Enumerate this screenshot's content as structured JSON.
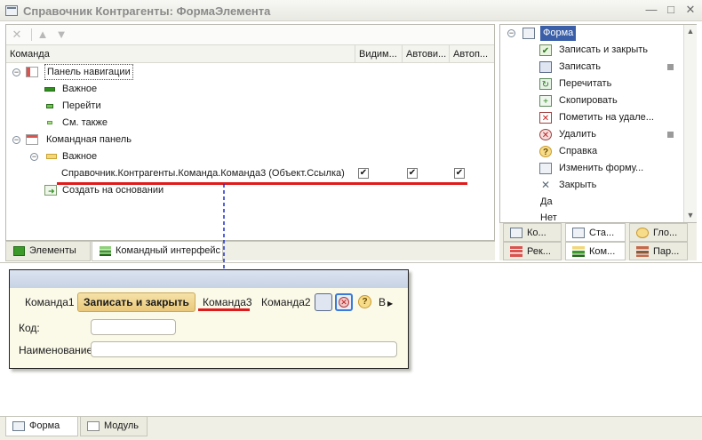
{
  "window": {
    "title": "Справочник Контрагенты: ФормаЭлемента",
    "minimize": "—",
    "maximize": "□",
    "close": "✕"
  },
  "toolbar": {
    "delete_icon": "delete-icon",
    "move_up_icon": "arrow-up-icon",
    "move_down_icon": "arrow-down-icon"
  },
  "commands_table": {
    "columns": [
      "Команда",
      "Видим...",
      "Автови...",
      "Автоп..."
    ],
    "rows": [
      {
        "label": "Панель навигации",
        "level": 0,
        "toggle": "−"
      },
      {
        "label": "Важное",
        "level": 1
      },
      {
        "label": "Перейти",
        "level": 1
      },
      {
        "label": "См. также",
        "level": 1
      },
      {
        "label": "Командная панель",
        "level": 0,
        "toggle": "−"
      },
      {
        "label": "Важное",
        "level": 1,
        "toggle": "−"
      },
      {
        "label": "Справочник.Контрагенты.Команда.Команда3 (Объект.Ссылка)",
        "level": 2,
        "checks": [
          true,
          true,
          true
        ]
      },
      {
        "label": "Создать на основании",
        "level": 1
      }
    ]
  },
  "left_tabs": [
    "Элементы",
    "Командный интерфейс"
  ],
  "form_tree": {
    "root": "Форма",
    "items": [
      {
        "label": "Записать и закрыть",
        "icon": "write-close-icon",
        "marked": false
      },
      {
        "label": "Записать",
        "icon": "save-icon",
        "marked": true
      },
      {
        "label": "Перечитать",
        "icon": "reread-icon",
        "marked": false
      },
      {
        "label": "Скопировать",
        "icon": "copy-icon",
        "marked": false
      },
      {
        "label": "Пометить на удале...",
        "icon": "mark-delete-icon",
        "marked": false
      },
      {
        "label": "Удалить",
        "icon": "delete-icon",
        "marked": true
      },
      {
        "label": "Справка",
        "icon": "help-icon",
        "marked": false
      },
      {
        "label": "Изменить форму...",
        "icon": "edit-form-icon",
        "marked": false
      },
      {
        "label": "Закрыть",
        "icon": "close-icon",
        "marked": false
      },
      {
        "label": "Да",
        "icon": "",
        "marked": false
      },
      {
        "label": "Нет",
        "icon": "",
        "marked": false
      }
    ]
  },
  "right_tabs_row1": [
    "Ко...",
    "Ста...",
    "Гло..."
  ],
  "right_tabs_row2": [
    "Рек...",
    "Ком...",
    "Пар..."
  ],
  "preview": {
    "buttons": {
      "command1": "Команда1",
      "write_close": "Записать и закрыть",
      "command3": "Команда3",
      "command2": "Команда2",
      "more": "В"
    },
    "fields": {
      "code_label": "Код:",
      "code_value": "",
      "name_label": "Наименование:",
      "name_value": ""
    }
  },
  "bottom_tabs": [
    "Форма",
    "Модуль"
  ],
  "colors": {
    "accent_red": "#e01b1b",
    "arrow_blue": "#1a2fd6",
    "primary_button": "#e9c87a"
  }
}
